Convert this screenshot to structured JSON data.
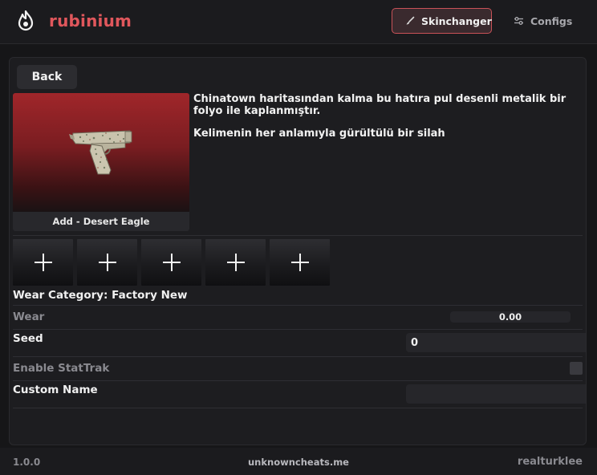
{
  "header": {
    "brand": "rubinium",
    "nav": [
      {
        "label": "Skinchanger",
        "icon": "brush-icon",
        "active": true
      },
      {
        "label": "Configs",
        "icon": "sliders-icon",
        "active": false
      }
    ],
    "accent_color": "#e0575c"
  },
  "main": {
    "back_label": "Back",
    "item_label": "Add - Desert Eagle",
    "description": [
      "Chinatown haritasından kalma bu hatıra pul desenli metalik bir folyo ile kaplanmıştır.",
      "Kelimenin her anlamıyla gürültülü bir silah"
    ],
    "sticker_slots": [
      "plus-icon",
      "plus-icon",
      "plus-icon",
      "plus-icon",
      "plus-icon"
    ],
    "wear_category": "Wear Category: Factory New",
    "wear": {
      "label": "Wear",
      "value": "0.00"
    },
    "seed": {
      "label": "Seed",
      "value": "0"
    },
    "stattrak": {
      "label": "Enable StatTrak",
      "checked": false
    },
    "custom_name": {
      "label": "Custom Name",
      "value": ""
    }
  },
  "footer": {
    "version": "1.0.0",
    "site": "unknowncheats.me",
    "author": "realturklee"
  }
}
